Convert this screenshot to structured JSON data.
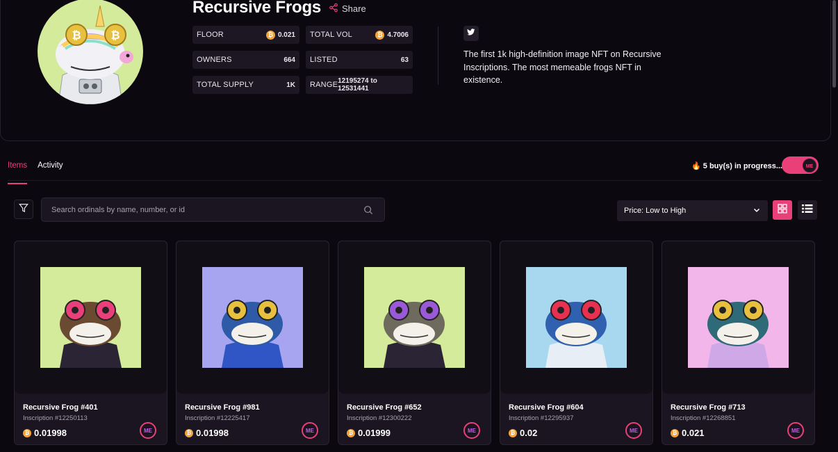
{
  "collection": {
    "title": "Recursive Frogs",
    "share_label": "Share",
    "description": "The first 1k high-definition image NFT on Recursive Inscriptions. The most memeable frogs NFT in existence.",
    "stats": {
      "floor": {
        "label": "FLOOR",
        "value": "0.021"
      },
      "total_vol": {
        "label": "TOTAL VOL",
        "value": "4.7006"
      },
      "owners": {
        "label": "OWNERS",
        "value": "664"
      },
      "listed": {
        "label": "LISTED",
        "value": "63"
      },
      "total_supply": {
        "label": "TOTAL SUPPLY",
        "value": "1K"
      },
      "range": {
        "label": "RANGE",
        "value": "12195274 to 12531441"
      }
    }
  },
  "tabs": [
    {
      "label": "Items",
      "active": true
    },
    {
      "label": "Activity",
      "active": false
    }
  ],
  "buy_status": {
    "icon": "🔥",
    "text": "5 buy(s) in progress..."
  },
  "search": {
    "placeholder": "Search ordinals by name, number, or id",
    "value": ""
  },
  "sort": {
    "selected": "Price: Low to High"
  },
  "colors": {
    "accent": "#e9407a",
    "btc": "#f2a33a",
    "background": "#0c0810",
    "card": "#1a1520"
  },
  "items": [
    {
      "name": "Recursive Frog #401",
      "inscription": "Inscription #12250113",
      "price": "0.01998",
      "bg": "#d3eb9a",
      "frog": "#6b4a32",
      "eye": "#e9407a",
      "shirt": "#2a2434"
    },
    {
      "name": "Recursive Frog #981",
      "inscription": "Inscription #12225417",
      "price": "0.01998",
      "bg": "#a8a5f0",
      "frog": "#2f5aa8",
      "eye": "#e8c040",
      "shirt": "#2f56c4"
    },
    {
      "name": "Recursive Frog #652",
      "inscription": "Inscription #12300222",
      "price": "0.01999",
      "bg": "#d3eb9a",
      "frog": "#6e6a5e",
      "eye": "#9a5ad8",
      "shirt": "#2a2434"
    },
    {
      "name": "Recursive Frog #604",
      "inscription": "Inscription #12295937",
      "price": "0.02",
      "bg": "#a8d8f0",
      "frog": "#3060b0",
      "eye": "#e83050",
      "shirt": "#e8eef6"
    },
    {
      "name": "Recursive Frog #713",
      "inscription": "Inscription #12268851",
      "price": "0.021",
      "bg": "#f3b6ea",
      "frog": "#2f6a78",
      "eye": "#e8c040",
      "shirt": "#cfa8e8"
    }
  ]
}
